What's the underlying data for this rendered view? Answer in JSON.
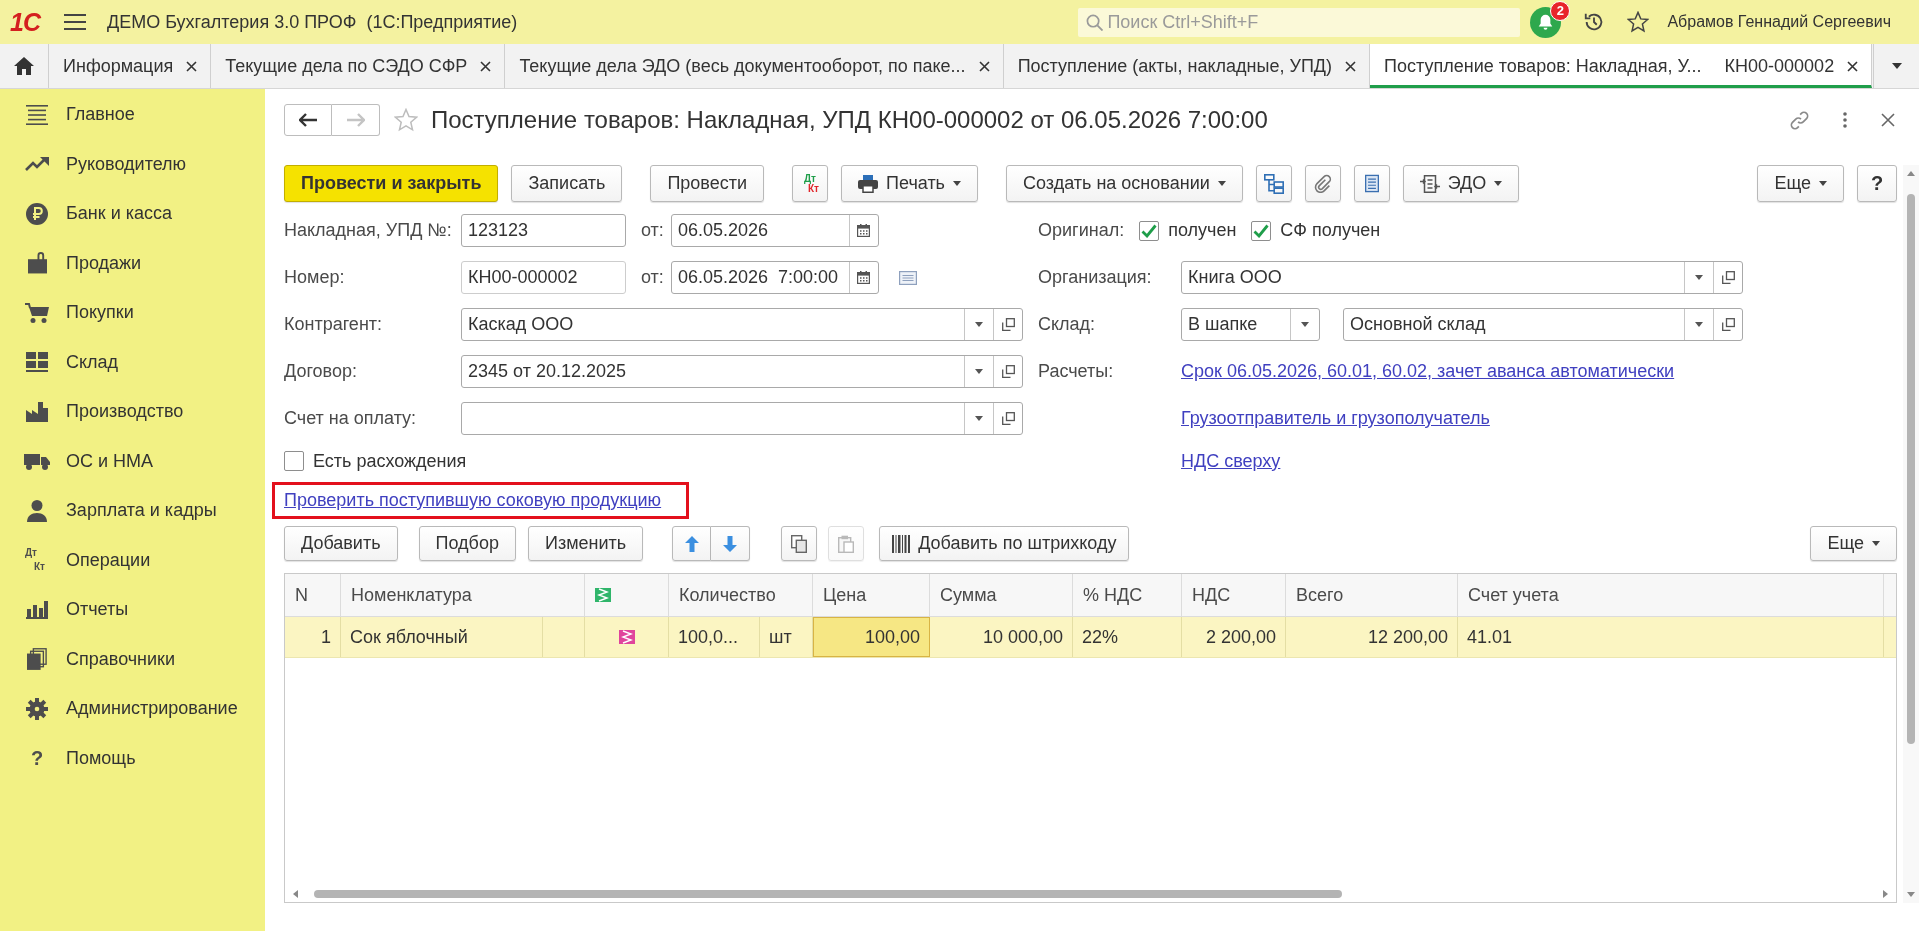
{
  "app_bar": {
    "logo": "1С",
    "title": "ДЕМО Бухгалтерия 3.0 ПРОФ  (1С:Предприятие)",
    "search": {
      "placeholder": "Поиск Ctrl+Shift+F"
    },
    "notification_count": "2",
    "user": "Абрамов Геннадий Сергеевич"
  },
  "tabs": [
    {
      "label": "Информация",
      "selected": false
    },
    {
      "label": "Текущие дела по СЭДО СФР",
      "selected": false
    },
    {
      "label": "Текущие дела ЭДО (весь документооборот, по паке...",
      "selected": false
    },
    {
      "label": "Поступление (акты, накладные, УПД)",
      "selected": false
    },
    {
      "label": "Поступление товаров: Накладная, У...",
      "number": "КН00-000002",
      "selected": true
    }
  ],
  "sidebar": {
    "items": [
      {
        "label": "Главное",
        "selected": false
      },
      {
        "label": "Руководителю",
        "selected": false
      },
      {
        "label": "Банк и касса",
        "selected": false
      },
      {
        "label": "Продажи",
        "selected": false
      },
      {
        "label": "Покупки",
        "selected": false
      },
      {
        "label": "Склад",
        "selected": false
      },
      {
        "label": "Производство",
        "selected": false
      },
      {
        "label": "ОС и НМА",
        "selected": false
      },
      {
        "label": "Зарплата и кадры",
        "selected": false
      },
      {
        "label": "Операции",
        "icon_letters": [
          "Дт",
          "Кт"
        ],
        "selected": false
      },
      {
        "label": "Отчеты",
        "selected": false
      },
      {
        "label": "Справочники",
        "selected": false
      },
      {
        "label": "Администрирование",
        "selected": false
      },
      {
        "label": "Помощь",
        "icon_letters": [
          "?"
        ],
        "selected": false
      }
    ]
  },
  "form": {
    "title": "Поступление товаров: Накладная, УПД КН00-000002 от 06.05.2026 7:00:00",
    "back": {
      "disabled": false
    },
    "forward": {
      "disabled": true
    },
    "toolbar": [
      {
        "kind": "primary",
        "label": "Провести и закрыть"
      },
      {
        "kind": "plain",
        "label": "Записать"
      },
      {
        "kind": "plain",
        "label": "Провести"
      },
      {
        "kind": "dtkt",
        "letters": [
          "Дт",
          "Кт"
        ]
      },
      {
        "kind": "print",
        "label": "Печать"
      },
      {
        "kind": "menu",
        "label": "Создать на основании"
      },
      {
        "kind": "structure"
      },
      {
        "kind": "attach"
      },
      {
        "kind": "document"
      },
      {
        "kind": "edo",
        "label": "ЭДО"
      },
      {
        "kind": "more",
        "label": "Еще"
      },
      {
        "kind": "help",
        "label": "?"
      }
    ],
    "invoice": {
      "label": "Накладная, УПД №:",
      "value": "123123",
      "date_label": "от:",
      "date": "06.05.2026"
    },
    "number": {
      "label": "Номер:",
      "value": "КН00-000002",
      "date_label": "от:",
      "date": "06.05.2026  7:00:00"
    },
    "counterparty": {
      "label": "Контрагент:",
      "value": "Каскад ООО"
    },
    "contract": {
      "label": "Договор:",
      "value": "2345 от 20.12.2025"
    },
    "payment_invoice": {
      "label": "Счет на оплату:"
    },
    "discrepancy": {
      "label": "Есть расхождения",
      "checked": false
    },
    "check_link": {
      "text": "Проверить поступившую соковую продукцию",
      "highlighted": true
    },
    "original": {
      "label": "Оригинал:",
      "options": [
        {
          "label": "получен",
          "checked": true
        },
        {
          "label": "СФ получен",
          "checked": true
        }
      ]
    },
    "organization": {
      "label": "Организация:",
      "value": "Книга ООО"
    },
    "warehouse": {
      "label": "Склад:",
      "mode": "В шапке",
      "value": "Основной склад"
    },
    "settlements": {
      "label": "Расчеты:",
      "link": "Срок 06.05.2026, 60.01, 60.02, зачет аванса автоматически"
    },
    "links": [
      "Грузоотправитель и грузополучатель",
      "НДС сверху"
    ]
  },
  "table_toolbar": [
    {
      "kind": "plain",
      "label": "Добавить",
      "disabled": false
    },
    {
      "kind": "plain",
      "label": "Подбор",
      "disabled": false
    },
    {
      "kind": "plain",
      "label": "Изменить",
      "disabled": false
    },
    {
      "kind": "up",
      "disabled": false
    },
    {
      "kind": "down",
      "disabled": false
    },
    {
      "kind": "copy",
      "disabled": false
    },
    {
      "kind": "paste",
      "disabled": true
    },
    {
      "kind": "barcode",
      "label": "Добавить по штрихкоду",
      "disabled": false
    },
    {
      "kind": "more",
      "label": "Еще",
      "disabled": false
    }
  ],
  "table": {
    "columns": [
      {
        "kind": "text",
        "label": "N"
      },
      {
        "kind": "text",
        "label": "Номенклатура"
      },
      {
        "kind": "marking"
      },
      {
        "kind": "text",
        "label": "Количество"
      },
      {
        "kind": "text",
        "label": "Цена"
      },
      {
        "kind": "text",
        "label": "Сумма"
      },
      {
        "kind": "text",
        "label": "% НДС"
      },
      {
        "kind": "text",
        "label": "НДС"
      },
      {
        "kind": "text",
        "label": "Всего"
      },
      {
        "kind": "text",
        "label": "Счет учета"
      }
    ],
    "rows": [
      {
        "n": "1",
        "item": "Сок яблочный",
        "quantity": "100,0...",
        "unit": "шт",
        "price": "100,00",
        "price_focused": true,
        "sum": "10 000,00",
        "vat_rate": "22%",
        "vat": "2 200,00",
        "total": "12 200,00",
        "account": "41.01",
        "selected": true
      }
    ]
  }
}
